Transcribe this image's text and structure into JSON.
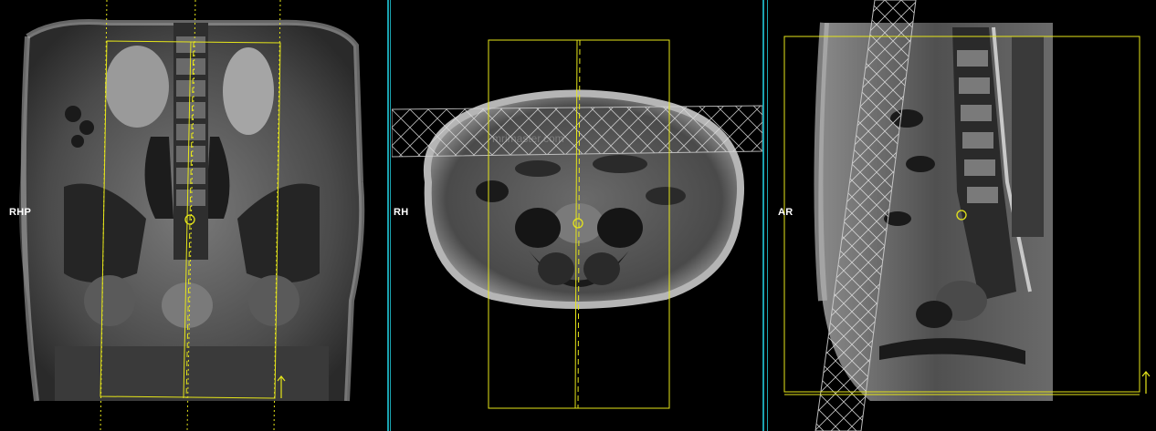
{
  "viewports": {
    "coronal": {
      "orientation_label": "RHP"
    },
    "axial": {
      "orientation_label": "RH",
      "watermark": "mrimaster.com"
    },
    "sagittal": {
      "orientation_label": "AR"
    }
  },
  "colors": {
    "planning_line": "#e6e61a",
    "viewport_divider": "#1aa3b0",
    "background": "#000000"
  },
  "icons": [
    "crosshair-circle-icon",
    "arrow-up-icon",
    "slice-band-hatch"
  ]
}
